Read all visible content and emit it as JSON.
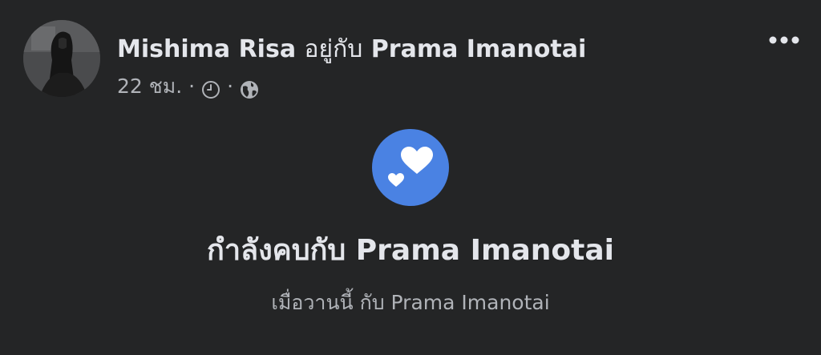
{
  "post": {
    "author_name": "Mishima Risa",
    "with_text": "อยู่กับ",
    "tagged_name": "Prama Imanotai",
    "time": "22 ชม.",
    "separator": "·",
    "icons": {
      "memory": "clock-icon",
      "audience": "globe-icon",
      "more": "more-options-icon",
      "event": "hearts-icon"
    },
    "event": {
      "title": "กำลังคบกับ Prama Imanotai",
      "subtitle": "เมื่อวานนี้ กับ Prama Imanotai"
    },
    "colors": {
      "background": "#242526",
      "primary_text": "#e4e6eb",
      "secondary_text": "#b0b3b8",
      "event_icon": "#4a82e3"
    }
  }
}
